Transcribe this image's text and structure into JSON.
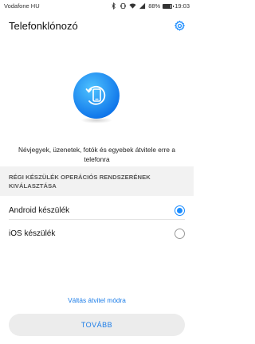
{
  "status_bar": {
    "carrier": "Vodafone HU",
    "battery_percent": "88%",
    "battery_level": 0.88,
    "time": "19:03",
    "icons": [
      "bluetooth-icon",
      "vibrate-icon",
      "wifi-icon",
      "signal-icon",
      "battery-icon"
    ]
  },
  "app_bar": {
    "title": "Telefonklónozó",
    "settings_icon": "gear-icon",
    "accent_color": "#1a8cff"
  },
  "hero": {
    "icon": "phone-transfer-icon"
  },
  "description": "Névjegyek, üzenetek, fotók és egyebek átvitele erre a telefonra",
  "section": {
    "header": "RÉGI KÉSZÜLÉK OPERÁCIÓS RENDSZERÉNEK KIVÁLASZTÁSA"
  },
  "options": [
    {
      "label": "Android készülék",
      "selected": true
    },
    {
      "label": "iOS készülék",
      "selected": false
    }
  ],
  "switch_link": "Váltás átvitel módra",
  "next_button": "TOVÁBB"
}
